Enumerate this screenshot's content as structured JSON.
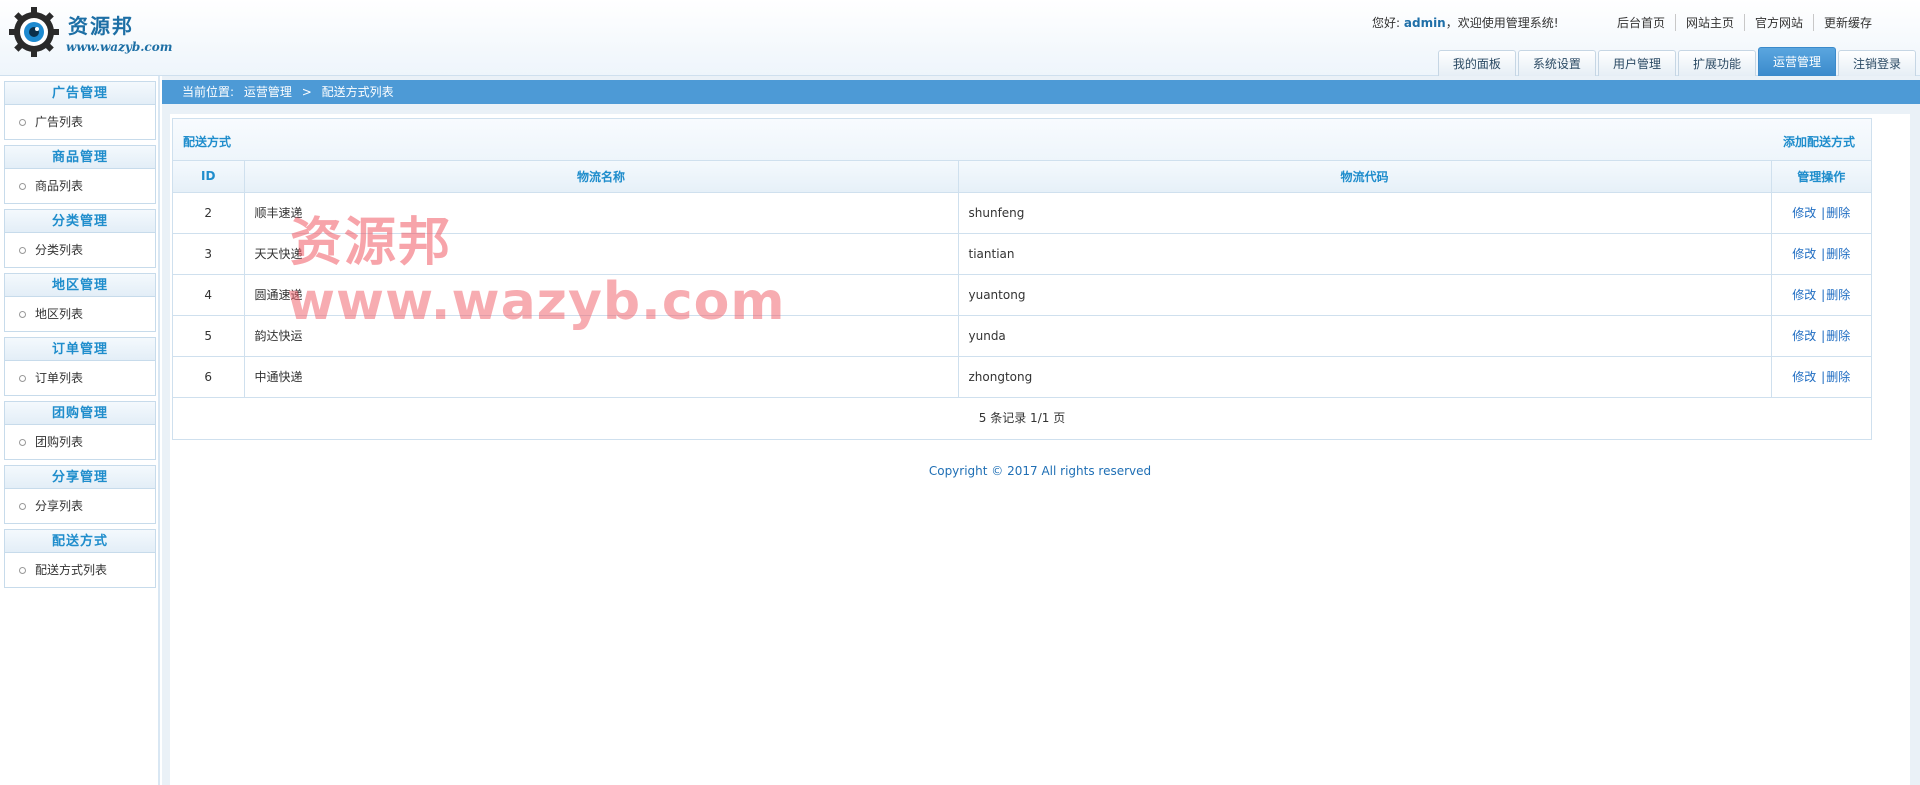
{
  "header": {
    "logo_name": "资源邦",
    "logo_url": "www.wazyb.com",
    "greeting_prefix": "您好:",
    "username": "admin",
    "greeting_suffix": "，欢迎使用管理系统!",
    "top_links": [
      "后台首页",
      "网站主页",
      "官方网站",
      "更新缓存"
    ],
    "nav_tabs": [
      "我的面板",
      "系统设置",
      "用户管理",
      "扩展功能",
      "运营管理",
      "注销登录"
    ],
    "active_tab": "运营管理"
  },
  "sidebar": {
    "groups": [
      {
        "title": "广告管理",
        "item": "广告列表"
      },
      {
        "title": "商品管理",
        "item": "商品列表"
      },
      {
        "title": "分类管理",
        "item": "分类列表"
      },
      {
        "title": "地区管理",
        "item": "地区列表"
      },
      {
        "title": "订单管理",
        "item": "订单列表"
      },
      {
        "title": "团购管理",
        "item": "团购列表"
      },
      {
        "title": "分享管理",
        "item": "分享列表"
      },
      {
        "title": "配送方式",
        "item": "配送方式列表"
      }
    ]
  },
  "breadcrumb": {
    "label": "当前位置:",
    "section": "运营管理",
    "separator": ">",
    "page": "配送方式列表"
  },
  "panel": {
    "title": "配送方式",
    "add_label": "添加配送方式",
    "columns": [
      "ID",
      "物流名称",
      "物流代码",
      "管理操作"
    ],
    "rows": [
      {
        "id": "2",
        "name": "顺丰速递",
        "code": "shunfeng"
      },
      {
        "id": "3",
        "name": "天天快递",
        "code": "tiantian"
      },
      {
        "id": "4",
        "name": "圆通速递",
        "code": "yuantong"
      },
      {
        "id": "5",
        "name": "韵达快运",
        "code": "yunda"
      },
      {
        "id": "6",
        "name": "中通快递",
        "code": "zhongtong"
      }
    ],
    "edit_label": "修改",
    "op_separator": "|",
    "delete_label": "删除",
    "pager_text": "5 条记录 1/1 页"
  },
  "footer": {
    "copyright": "Copyright © 2017 All rights reserved"
  },
  "watermark": {
    "line1": "资源邦",
    "line2": "www.wazyb.com"
  },
  "colors": {
    "accent": "#1f8dcc",
    "breadcrumb_bar": "#4d9ad6",
    "active_tab": "#3a8acb",
    "link": "#1e6cc2"
  }
}
